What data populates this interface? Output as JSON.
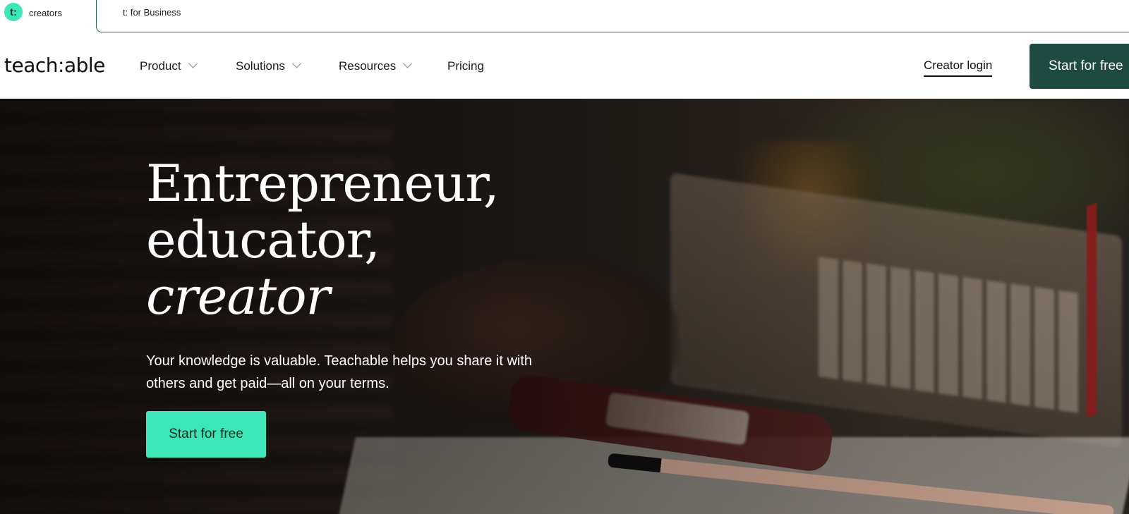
{
  "switcher": {
    "badge": "t:",
    "active_label": "creators",
    "business_label": "t: for Business"
  },
  "nav": {
    "logo": "teach:able",
    "items": [
      {
        "label": "Product",
        "has_dropdown": true
      },
      {
        "label": "Solutions",
        "has_dropdown": true
      },
      {
        "label": "Resources",
        "has_dropdown": true
      },
      {
        "label": "Pricing",
        "has_dropdown": false
      }
    ],
    "login_label": "Creator login",
    "cta_label": "Start for free"
  },
  "hero": {
    "headline_line1": "Entrepreneur,",
    "headline_line2": "educator,",
    "headline_line3": "creator",
    "subtitle": "Your knowledge is valuable. Teachable helps you share it with others and get paid—all on your terms.",
    "cta_label": "Start for free"
  },
  "colors": {
    "accent": "#3ce6b6",
    "dark_green": "#1d4a41",
    "hero_bg": "#241f1b"
  }
}
